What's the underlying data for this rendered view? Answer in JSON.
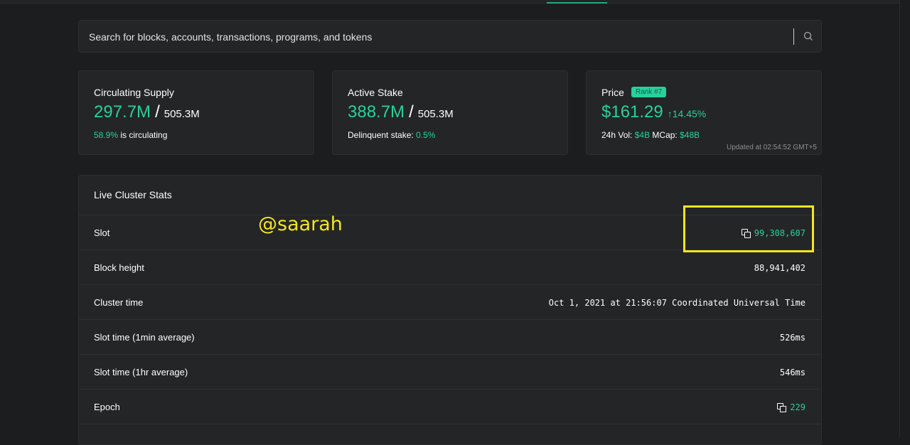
{
  "search": {
    "placeholder": "Search for blocks, accounts, transactions, programs, and tokens"
  },
  "cards": {
    "supply": {
      "title": "Circulating Supply",
      "value": "297.7M",
      "slash": "/",
      "total": "505.3M",
      "percent": "58.9%",
      "foot_text": " is circulating"
    },
    "stake": {
      "title": "Active Stake",
      "value": "388.7M",
      "slash": "/",
      "total": "505.3M",
      "foot_label": "Delinquent stake: ",
      "delinquent": "0.5%"
    },
    "price": {
      "title": "Price",
      "rank": "Rank #7",
      "value": "$161.29",
      "change": "↑14.45%",
      "vol_label": "24h Vol: ",
      "vol": "$4B",
      "mcap_label": " MCap: ",
      "mcap": "$48B",
      "updated": "Updated at 02:54:52 GMT+5"
    }
  },
  "stats": {
    "title": "Live Cluster Stats",
    "rows": [
      {
        "label": "Slot",
        "value": "99,308,607"
      },
      {
        "label": "Block height",
        "value": "88,941,402"
      },
      {
        "label": "Cluster time",
        "value": "Oct 1, 2021 at 21:56:07 Coordinated Universal Time"
      },
      {
        "label": "Slot time (1min average)",
        "value": "526ms"
      },
      {
        "label": "Slot time (1hr average)",
        "value": "546ms"
      },
      {
        "label": "Epoch",
        "value": "229"
      }
    ]
  },
  "overlay": {
    "watermark": "@saarah"
  },
  "colors": {
    "accent": "#26d19c",
    "background": "#1c1d1e",
    "card": "#232526",
    "highlight": "#f5e51e"
  }
}
